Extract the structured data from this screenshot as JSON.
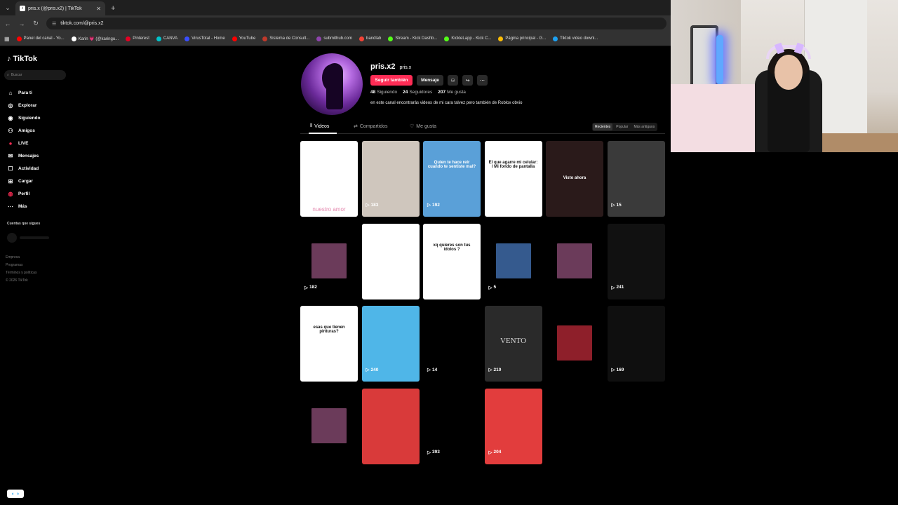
{
  "browser": {
    "tab_title": "pris.x (@pris.x2) | TikTok",
    "tab_close": "✕",
    "new_tab": "+",
    "url": "tiktok.com/@pris.x2",
    "bookmarks": [
      {
        "label": "Panel del canal - Yo...",
        "color": "#ff0000"
      },
      {
        "label": "Karin 💗 (@karingu...",
        "color": "#ffffff"
      },
      {
        "label": "Pinterest",
        "color": "#e60023"
      },
      {
        "label": "CANVA",
        "color": "#00c4cc"
      },
      {
        "label": "VirusTotal - Home",
        "color": "#394eff"
      },
      {
        "label": "YouTube",
        "color": "#ff0000"
      },
      {
        "label": "Sistema de Consult...",
        "color": "#c0392b"
      },
      {
        "label": "submithub.com",
        "color": "#8e44ad"
      },
      {
        "label": "bandlab",
        "color": "#f44336"
      },
      {
        "label": "Stream - Kick Dashb...",
        "color": "#53fc18"
      },
      {
        "label": "KickleLapp - Kick C...",
        "color": "#53fc18"
      },
      {
        "label": "Página principal - G...",
        "color": "#fbbc05"
      },
      {
        "label": "Tiktok video downl...",
        "color": "#1da1f2"
      }
    ]
  },
  "sidebar": {
    "logo": "TikTok",
    "search_placeholder": "Buscar",
    "items": [
      {
        "label": "Para ti",
        "icon": "home-icon"
      },
      {
        "label": "Explorar",
        "icon": "compass-icon"
      },
      {
        "label": "Siguiendo",
        "icon": "following-icon"
      },
      {
        "label": "Amigos",
        "icon": "friends-icon"
      },
      {
        "label": "LIVE",
        "icon": "live-icon"
      },
      {
        "label": "Mensajes",
        "icon": "messages-icon"
      },
      {
        "label": "Actividad",
        "icon": "activity-icon"
      },
      {
        "label": "Cargar",
        "icon": "upload-icon"
      },
      {
        "label": "Perfil",
        "icon": "profile-icon"
      },
      {
        "label": "Más",
        "icon": "more-icon"
      }
    ],
    "following_title": "Cuentas que sigues",
    "footer": [
      "Empresa",
      "Programas",
      "Términos y políticas",
      "© 2026 TikTok"
    ]
  },
  "profile": {
    "username": "pris.x2",
    "nickname": "pris.x",
    "follow_label": "Seguir también",
    "message_label": "Mensaje",
    "following_count": "48",
    "following_label": "Siguiendo",
    "followers_count": "24",
    "followers_label": "Seguidores",
    "likes_count": "207",
    "likes_label": "Me gusta",
    "bio": "en este canal encontrarás videos de mi cara talvez pero también de Roblox obvio"
  },
  "tabs": {
    "videos": "Videos",
    "reposts": "Compartidos",
    "liked": "Me gusta",
    "sort": [
      "Recientes",
      "Popular",
      "Más antiguos"
    ]
  },
  "videos": [
    {
      "views": "",
      "overlay": "nuestro amor",
      "bg": "#ffffff"
    },
    {
      "views": "183",
      "overlay": "",
      "bg": "#cfc6bd"
    },
    {
      "views": "192",
      "overlay": "Quien te hace reir cuando te sentiste mal?",
      "bg": "#5aa0d8"
    },
    {
      "views": "",
      "overlay": "El que agarre mi celular: / Mi fondo de pantalla",
      "bg": "#ffffff"
    },
    {
      "views": "",
      "overlay": "Visto ahora",
      "bg": "#2a1a1a"
    },
    {
      "views": "15",
      "overlay": "",
      "bg": "#3a3a3a"
    },
    {
      "views": "182",
      "overlay": "",
      "bg": "#000000"
    },
    {
      "views": "",
      "overlay": "",
      "bg": "#ffffff"
    },
    {
      "views": "",
      "overlay": "xq quieres son tus ídolos ?",
      "bg": "#ffffff"
    },
    {
      "views": "5",
      "overlay": "",
      "bg": "#000000"
    },
    {
      "views": "",
      "overlay": "",
      "bg": "#000000"
    },
    {
      "views": "241",
      "overlay": "",
      "bg": "#111111"
    },
    {
      "views": "",
      "overlay": "esas que tienen pinturas?",
      "bg": "#ffffff"
    },
    {
      "views": "240",
      "overlay": "",
      "bg": "#4fb6e8"
    },
    {
      "views": "14",
      "overlay": "",
      "bg": "#000000"
    },
    {
      "views": "210",
      "overlay": "VENTO",
      "bg": "#2a2a2a"
    },
    {
      "views": "",
      "overlay": "",
      "bg": "#000000"
    },
    {
      "views": "169",
      "overlay": "",
      "bg": "#0f0f0f"
    },
    {
      "views": "",
      "overlay": "",
      "bg": "#000000"
    },
    {
      "views": "",
      "overlay": "",
      "bg": "#d93a3a"
    },
    {
      "views": "393",
      "overlay": "",
      "bg": "#000000"
    },
    {
      "views": "204",
      "overlay": "",
      "bg": "#e23d3d"
    }
  ]
}
